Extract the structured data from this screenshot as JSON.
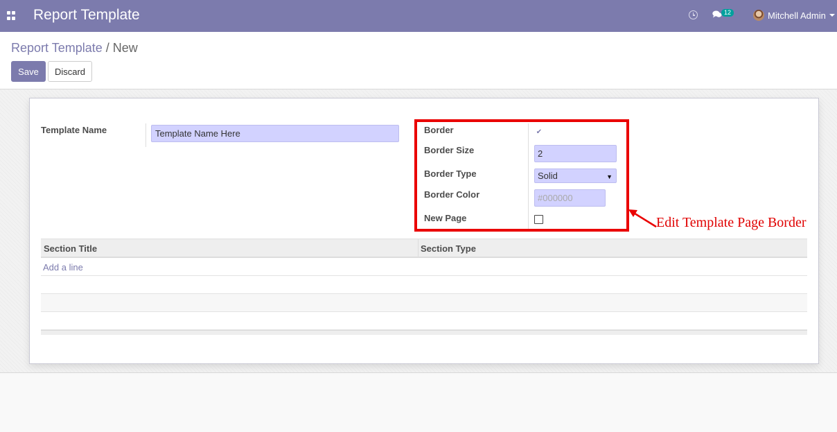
{
  "navbar": {
    "app_title": "Report Template",
    "chat_badge": "12",
    "user_name": "Mitchell Admin",
    "icons": [
      "apps-icon",
      "clock-icon",
      "chat-icon",
      "avatar",
      "caret-down-icon"
    ],
    "bar_color": "#7c7bad"
  },
  "breadcrumb": {
    "parent": "Report Template",
    "separator": "/",
    "current": "New"
  },
  "buttons": {
    "save": "Save",
    "discard": "Discard"
  },
  "form": {
    "template_name_label": "Template Name",
    "template_name_value": "Template Name Here",
    "border_label": "Border",
    "border_checked": true,
    "border_size_label": "Border Size",
    "border_size_value": "2",
    "border_type_label": "Border Type",
    "border_type_value": "Solid",
    "border_color_label": "Border Color",
    "border_color_placeholder": "#000000",
    "new_page_label": "New Page",
    "new_page_checked": false,
    "input_bg_color": "#d2d2ff"
  },
  "annotation": {
    "text": "Edit Template Page Border",
    "color": "#ea0000"
  },
  "table": {
    "columns": [
      "Section Title",
      "Section Type"
    ],
    "add_line": "Add a line"
  }
}
